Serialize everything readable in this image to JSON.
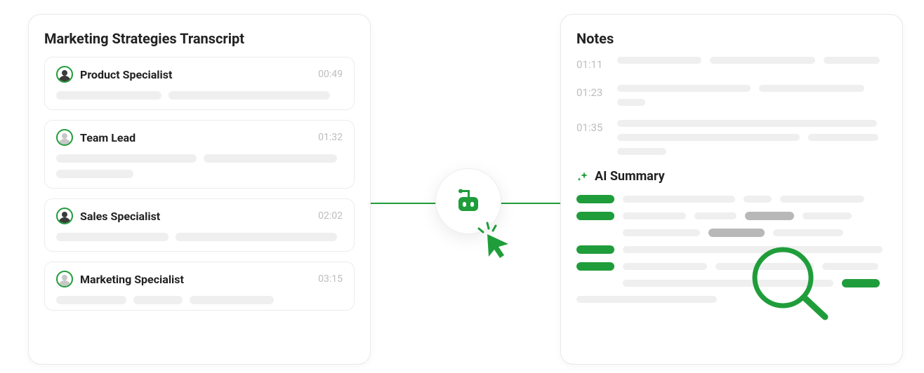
{
  "colors": {
    "accent": "#1f9d3a",
    "muted": "#efefef",
    "text": "#222",
    "subtle": "#bdbdbd"
  },
  "transcript": {
    "title": "Marketing Strategies Transcript",
    "entries": [
      {
        "speaker": "Product Specialist",
        "time": "00:49",
        "avatar": "dark"
      },
      {
        "speaker": "Team Lead",
        "time": "01:32",
        "avatar": "light"
      },
      {
        "speaker": "Sales Specialist",
        "time": "02:02",
        "avatar": "dark"
      },
      {
        "speaker": "Marketing Specialist",
        "time": "03:15",
        "avatar": "light"
      }
    ]
  },
  "notes": {
    "title": "Notes",
    "rows": [
      {
        "time": "01:11"
      },
      {
        "time": "01:23"
      },
      {
        "time": "01:35"
      }
    ],
    "ai_summary_label": "AI Summary"
  },
  "icons": {
    "bot": "bot-icon",
    "sparkle": "sparkle-icon",
    "cursor": "cursor-click-icon",
    "magnifier": "magnifier-icon"
  }
}
